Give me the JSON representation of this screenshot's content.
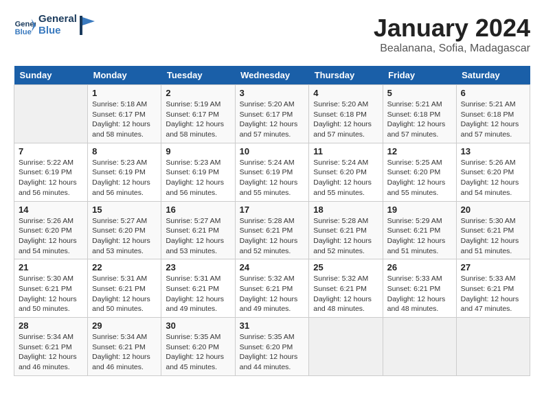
{
  "logo": {
    "line1": "General",
    "line2": "Blue"
  },
  "title": "January 2024",
  "subtitle": "Bealanana, Sofia, Madagascar",
  "header_days": [
    "Sunday",
    "Monday",
    "Tuesday",
    "Wednesday",
    "Thursday",
    "Friday",
    "Saturday"
  ],
  "weeks": [
    [
      {
        "num": "",
        "info": ""
      },
      {
        "num": "1",
        "info": "Sunrise: 5:18 AM\nSunset: 6:17 PM\nDaylight: 12 hours\nand 58 minutes."
      },
      {
        "num": "2",
        "info": "Sunrise: 5:19 AM\nSunset: 6:17 PM\nDaylight: 12 hours\nand 58 minutes."
      },
      {
        "num": "3",
        "info": "Sunrise: 5:20 AM\nSunset: 6:17 PM\nDaylight: 12 hours\nand 57 minutes."
      },
      {
        "num": "4",
        "info": "Sunrise: 5:20 AM\nSunset: 6:18 PM\nDaylight: 12 hours\nand 57 minutes."
      },
      {
        "num": "5",
        "info": "Sunrise: 5:21 AM\nSunset: 6:18 PM\nDaylight: 12 hours\nand 57 minutes."
      },
      {
        "num": "6",
        "info": "Sunrise: 5:21 AM\nSunset: 6:18 PM\nDaylight: 12 hours\nand 57 minutes."
      }
    ],
    [
      {
        "num": "7",
        "info": "Sunrise: 5:22 AM\nSunset: 6:19 PM\nDaylight: 12 hours\nand 56 minutes."
      },
      {
        "num": "8",
        "info": "Sunrise: 5:23 AM\nSunset: 6:19 PM\nDaylight: 12 hours\nand 56 minutes."
      },
      {
        "num": "9",
        "info": "Sunrise: 5:23 AM\nSunset: 6:19 PM\nDaylight: 12 hours\nand 56 minutes."
      },
      {
        "num": "10",
        "info": "Sunrise: 5:24 AM\nSunset: 6:19 PM\nDaylight: 12 hours\nand 55 minutes."
      },
      {
        "num": "11",
        "info": "Sunrise: 5:24 AM\nSunset: 6:20 PM\nDaylight: 12 hours\nand 55 minutes."
      },
      {
        "num": "12",
        "info": "Sunrise: 5:25 AM\nSunset: 6:20 PM\nDaylight: 12 hours\nand 55 minutes."
      },
      {
        "num": "13",
        "info": "Sunrise: 5:26 AM\nSunset: 6:20 PM\nDaylight: 12 hours\nand 54 minutes."
      }
    ],
    [
      {
        "num": "14",
        "info": "Sunrise: 5:26 AM\nSunset: 6:20 PM\nDaylight: 12 hours\nand 54 minutes."
      },
      {
        "num": "15",
        "info": "Sunrise: 5:27 AM\nSunset: 6:20 PM\nDaylight: 12 hours\nand 53 minutes."
      },
      {
        "num": "16",
        "info": "Sunrise: 5:27 AM\nSunset: 6:21 PM\nDaylight: 12 hours\nand 53 minutes."
      },
      {
        "num": "17",
        "info": "Sunrise: 5:28 AM\nSunset: 6:21 PM\nDaylight: 12 hours\nand 52 minutes."
      },
      {
        "num": "18",
        "info": "Sunrise: 5:28 AM\nSunset: 6:21 PM\nDaylight: 12 hours\nand 52 minutes."
      },
      {
        "num": "19",
        "info": "Sunrise: 5:29 AM\nSunset: 6:21 PM\nDaylight: 12 hours\nand 51 minutes."
      },
      {
        "num": "20",
        "info": "Sunrise: 5:30 AM\nSunset: 6:21 PM\nDaylight: 12 hours\nand 51 minutes."
      }
    ],
    [
      {
        "num": "21",
        "info": "Sunrise: 5:30 AM\nSunset: 6:21 PM\nDaylight: 12 hours\nand 50 minutes."
      },
      {
        "num": "22",
        "info": "Sunrise: 5:31 AM\nSunset: 6:21 PM\nDaylight: 12 hours\nand 50 minutes."
      },
      {
        "num": "23",
        "info": "Sunrise: 5:31 AM\nSunset: 6:21 PM\nDaylight: 12 hours\nand 49 minutes."
      },
      {
        "num": "24",
        "info": "Sunrise: 5:32 AM\nSunset: 6:21 PM\nDaylight: 12 hours\nand 49 minutes."
      },
      {
        "num": "25",
        "info": "Sunrise: 5:32 AM\nSunset: 6:21 PM\nDaylight: 12 hours\nand 48 minutes."
      },
      {
        "num": "26",
        "info": "Sunrise: 5:33 AM\nSunset: 6:21 PM\nDaylight: 12 hours\nand 48 minutes."
      },
      {
        "num": "27",
        "info": "Sunrise: 5:33 AM\nSunset: 6:21 PM\nDaylight: 12 hours\nand 47 minutes."
      }
    ],
    [
      {
        "num": "28",
        "info": "Sunrise: 5:34 AM\nSunset: 6:21 PM\nDaylight: 12 hours\nand 46 minutes."
      },
      {
        "num": "29",
        "info": "Sunrise: 5:34 AM\nSunset: 6:21 PM\nDaylight: 12 hours\nand 46 minutes."
      },
      {
        "num": "30",
        "info": "Sunrise: 5:35 AM\nSunset: 6:20 PM\nDaylight: 12 hours\nand 45 minutes."
      },
      {
        "num": "31",
        "info": "Sunrise: 5:35 AM\nSunset: 6:20 PM\nDaylight: 12 hours\nand 44 minutes."
      },
      {
        "num": "",
        "info": ""
      },
      {
        "num": "",
        "info": ""
      },
      {
        "num": "",
        "info": ""
      }
    ]
  ]
}
